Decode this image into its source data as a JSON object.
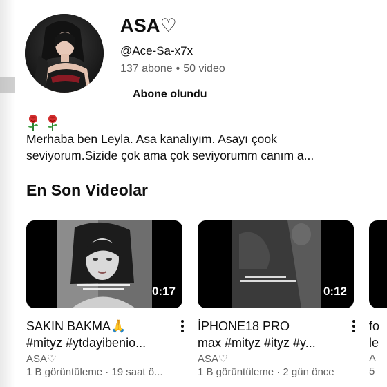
{
  "channel": {
    "name": "ASA♡",
    "handle": "@Ace-Sa-x7x",
    "subscribers": "137 abone",
    "separator": "•",
    "videos": "50 video",
    "subscribe_label": "Abone olundu",
    "description_line1": "Merhaba ben Leyla. Asa kanalıyım. Asayı çook",
    "description_line2": "seviyorum.Sizide çok ama çok seviyorumm canım a..."
  },
  "section": {
    "title": "En Son Videolar"
  },
  "videos": [
    {
      "duration": "0:17",
      "title_line1": "SAKIN BAKMA🙏",
      "title_line2": "#mityz #ytdayibenio...",
      "owner": "ASA♡",
      "stats": "1 B görüntüleme · 19 saat ö..."
    },
    {
      "duration": "0:12",
      "title_line1": "İPHONE18 PRO",
      "title_line2": "max #mityz #ityz #y...",
      "owner": "ASA♡",
      "stats": "1 B görüntüleme · 2 gün önce"
    },
    {
      "title_line1": "fo",
      "title_line2": "le",
      "owner": "A",
      "stats": "5"
    }
  ],
  "icons": {
    "rose": "rose-icon",
    "more": "more-vert-icon"
  },
  "colors": {
    "secondary_text": "#606060",
    "primary_text": "#0f0f0f",
    "background": "#ffffff"
  }
}
